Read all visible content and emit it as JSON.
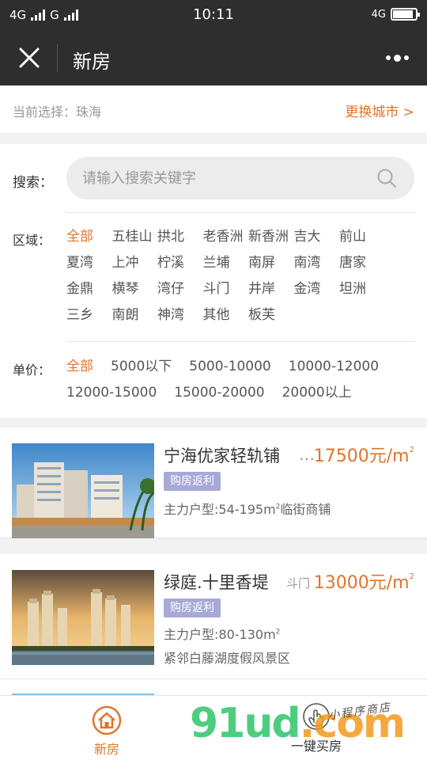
{
  "status_bar": {
    "signal_left": "4G",
    "signal_mid": "G",
    "time": "10:11",
    "signal_right": "4G",
    "battery_level": 0.9
  },
  "nav": {
    "title": "新房",
    "close_icon": "close-icon",
    "more_icon": "more-icon"
  },
  "city": {
    "current": "当前选择：珠海",
    "change_label": "更换城市 >"
  },
  "search": {
    "label": "搜索：",
    "placeholder": "请输入搜索关键字"
  },
  "area": {
    "label": "区域：",
    "options": [
      "全部",
      "五桂山",
      "拱北",
      "老香洲",
      "新香洲",
      "吉大",
      "前山",
      "夏湾",
      "上冲",
      "柠溪",
      "兰埔",
      "南屏",
      "南湾",
      "唐家",
      "金鼎",
      "横琴",
      "湾仔",
      "斗门",
      "井岸",
      "金湾",
      "坦洲",
      "三乡",
      "南朗",
      "神湾",
      "其他",
      "板芙"
    ]
  },
  "price": {
    "label": "单价：",
    "options": [
      "全部",
      "5000以下",
      "5000-10000",
      "10000-12000",
      "12000-15000",
      "15000-20000",
      "20000以上"
    ]
  },
  "listings": [
    {
      "name": "宁海优家轻轨铺",
      "district": "…",
      "price": "17500元/m",
      "price_sup": "2",
      "badge": "购房返利",
      "line1": "主力户型:54-195m",
      "line1_sup": "2",
      "line1_tail": "临街商铺",
      "line2": ""
    },
    {
      "name": "绿庭.十里香堤",
      "district": "斗门",
      "price": "13000元/m",
      "price_sup": "2",
      "badge": "购房返利",
      "line1": "主力户型:80-130m",
      "line1_sup": "2",
      "line1_tail": "",
      "line2": "紧邻白藤湖度假风景区"
    }
  ],
  "tabs": {
    "new_home": "新房",
    "buy_home": "一键买房"
  },
  "watermark": {
    "main": "91ud",
    "suffix": ".com",
    "sub": "小程序商店"
  },
  "colors": {
    "accent": "#e0742c",
    "badge": "#a7a9d7",
    "navbar": "#2e2e2e"
  }
}
